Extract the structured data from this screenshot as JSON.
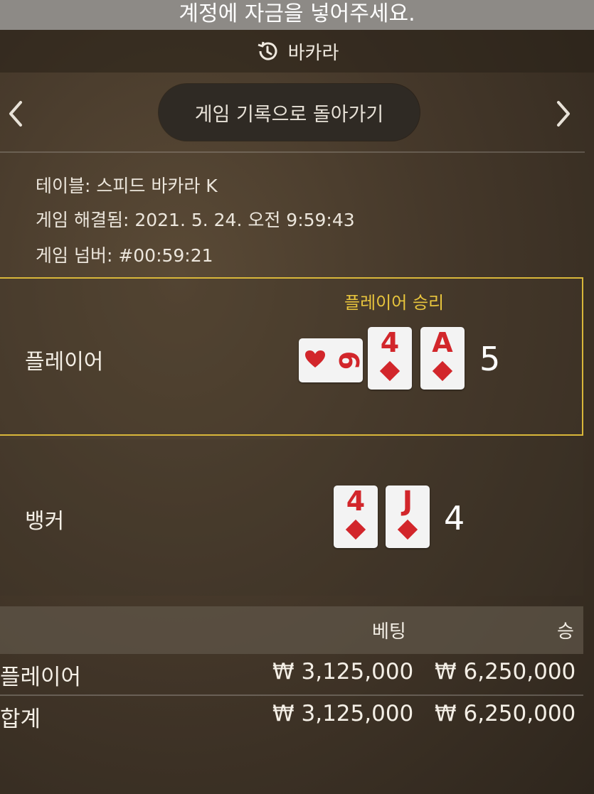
{
  "banner": {
    "text": "계정에 자금을 넣어주세요."
  },
  "topbar": {
    "title": "바카라",
    "icon": "history-icon"
  },
  "nav": {
    "back_button": "게임 기록으로 돌아가기",
    "prev_icon": "chevron-left-icon",
    "next_icon": "chevron-right-icon"
  },
  "info": {
    "table": "테이블: 스피드 바카라 K",
    "resolved": "게임 해결됨: 2021. 5. 24. 오전 9:59:43",
    "number": "게임 넘버: #00:59:21"
  },
  "player": {
    "label": "플레이어",
    "result": "플레이어 승리",
    "score": "5",
    "cards": [
      {
        "rank": "6",
        "suit": "hearts",
        "orientation": "sideways"
      },
      {
        "rank": "4",
        "suit": "diamonds"
      },
      {
        "rank": "A",
        "suit": "diamonds"
      }
    ]
  },
  "banker": {
    "label": "뱅커",
    "score": "4",
    "cards": [
      {
        "rank": "4",
        "suit": "diamonds"
      },
      {
        "rank": "J",
        "suit": "diamonds"
      }
    ]
  },
  "bets_table": {
    "headers": {
      "bet": "베팅",
      "win": "승"
    },
    "rows": [
      {
        "name": "플레이어",
        "bet": "₩ 3,125,000",
        "win": "₩ 6,250,000"
      },
      {
        "name": "합계",
        "bet": "₩ 3,125,000",
        "win": "₩ 6,250,000"
      }
    ]
  },
  "colors": {
    "highlight": "#d9b73a",
    "card_red": "#d2262b"
  }
}
